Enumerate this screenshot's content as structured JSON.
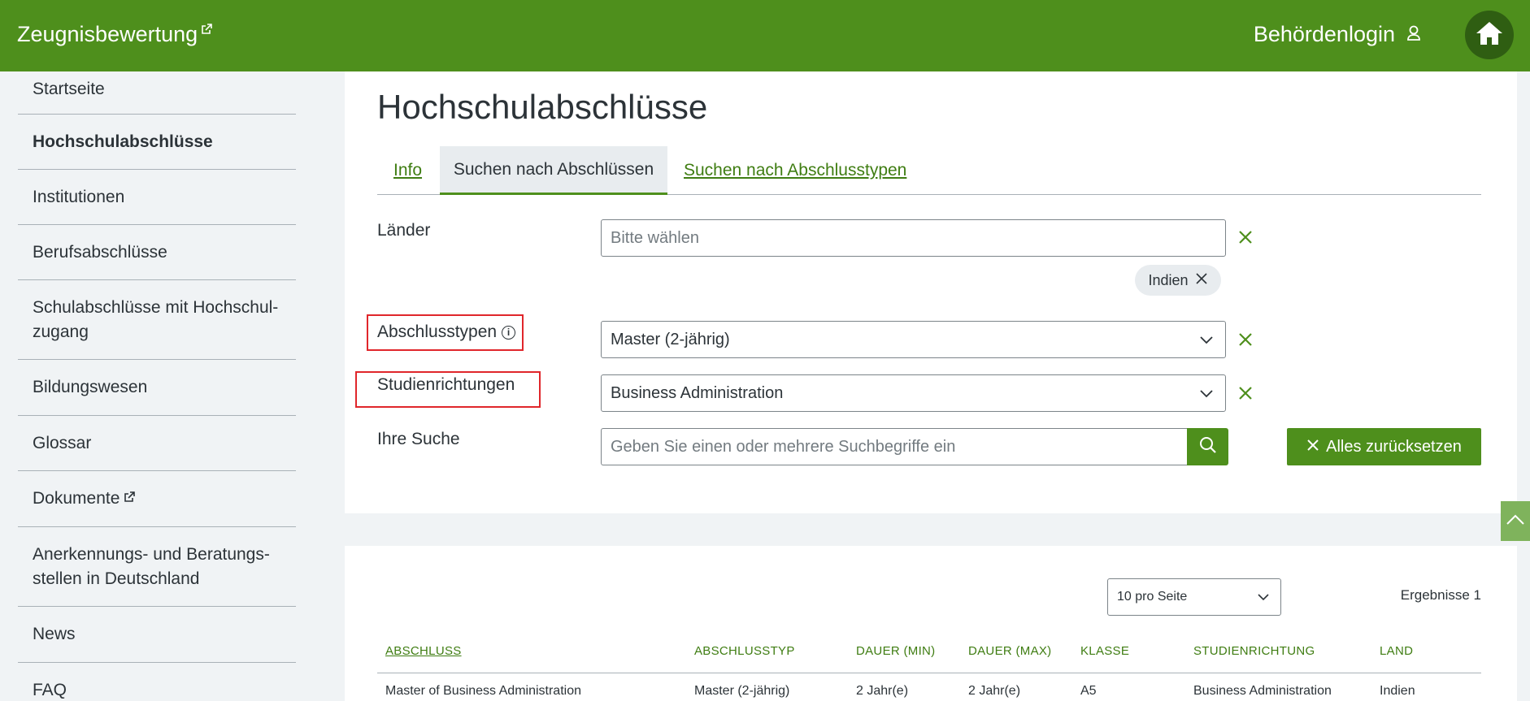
{
  "header": {
    "brand": "Zeugnisbewertung",
    "login_label": "Behördenlogin"
  },
  "sidebar": {
    "items": [
      {
        "label": "Startseite"
      },
      {
        "label": "Hochschulabschlüsse",
        "active": true
      },
      {
        "label": "Institutionen"
      },
      {
        "label": "Berufsabschlüsse"
      },
      {
        "label": "Schulabschlüsse mit Hochschul-",
        "label2": "zugang"
      },
      {
        "label": "Bildungswesen"
      },
      {
        "label": "Glossar"
      },
      {
        "label": "Dokumente",
        "external": true
      },
      {
        "label": "Anerkennungs- und Beratungs-",
        "label2": "stellen in Deutschland"
      },
      {
        "label": "News"
      },
      {
        "label": "FAQ"
      }
    ]
  },
  "page": {
    "title": "Hochschulabschlüsse",
    "tabs": [
      {
        "label": "Info"
      },
      {
        "label": "Suchen nach Abschlüssen",
        "selected": true
      },
      {
        "label": "Suchen nach Abschlusstypen"
      }
    ]
  },
  "filters": {
    "countries": {
      "label": "Länder",
      "placeholder": "Bitte wählen",
      "chip": "Indien"
    },
    "degree_types": {
      "label": "Abschlusstypen",
      "value": "Master (2-jährig)"
    },
    "fields_of_study": {
      "label": "Studienrichtungen",
      "value": "Business Administration"
    },
    "search": {
      "label": "Ihre Suche",
      "placeholder": "Geben Sie einen oder mehrere Suchbegriffe ein"
    },
    "reset_label": "Alles zurücksetzen"
  },
  "results": {
    "per_page": "10 pro Seite",
    "count_text": "Ergebnisse 1",
    "columns": [
      "ABSCHLUSS",
      "ABSCHLUSSTYP",
      "DAUER (MIN)",
      "DAUER (MAX)",
      "KLASSE",
      "STUDIENRICHTUNG",
      "LAND"
    ],
    "rows": [
      [
        "Master of Business Administration",
        "Master (2-jährig)",
        "2 Jahr(e)",
        "2 Jahr(e)",
        "A5",
        "Business Administration",
        "Indien"
      ]
    ]
  },
  "colors": {
    "brand_green": "#4e8f1c",
    "link_green": "#3f7d12",
    "highlight_red": "#e0262b"
  }
}
